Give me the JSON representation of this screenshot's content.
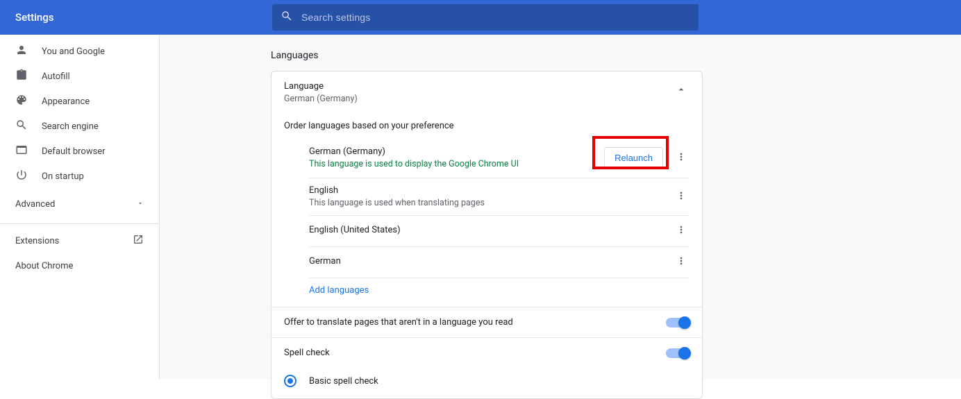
{
  "header": {
    "title": "Settings",
    "search_placeholder": "Search settings"
  },
  "sidebar": {
    "items": [
      {
        "label": "You and Google"
      },
      {
        "label": "Autofill"
      },
      {
        "label": "Appearance"
      },
      {
        "label": "Search engine"
      },
      {
        "label": "Default browser"
      },
      {
        "label": "On startup"
      }
    ],
    "advanced_label": "Advanced",
    "extensions_label": "Extensions",
    "about_label": "About Chrome"
  },
  "main": {
    "heading": "Languages",
    "lang_title": "Language",
    "lang_current": "German (Germany)",
    "order_text": "Order languages based on your preference",
    "languages": [
      {
        "name": "German (Germany)",
        "note": "This language is used to display the Google Chrome UI",
        "note_type": "ui",
        "relaunch": true
      },
      {
        "name": "English",
        "note": "This language is used when translating pages",
        "note_type": "sub",
        "relaunch": false
      },
      {
        "name": "English (United States)",
        "note": "",
        "note_type": "sub",
        "relaunch": false
      },
      {
        "name": "German",
        "note": "",
        "note_type": "sub",
        "relaunch": false
      }
    ],
    "relaunch_label": "Relaunch",
    "add_label": "Add languages",
    "offer_translate_label": "Offer to translate pages that aren't in a language you read",
    "spell_check_label": "Spell check",
    "basic_spell_label": "Basic spell check"
  }
}
